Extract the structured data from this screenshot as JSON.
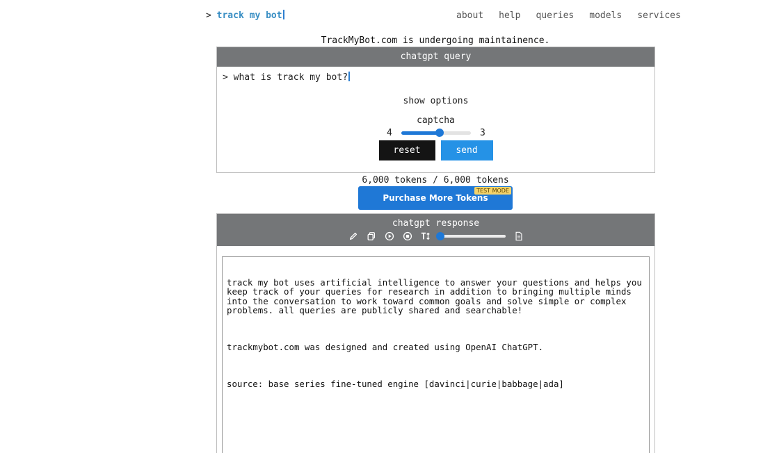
{
  "header": {
    "prompt_symbol": ">",
    "brand": "track my bot",
    "nav": [
      "about",
      "help",
      "queries",
      "models",
      "services"
    ]
  },
  "notice": "TrackMyBot.com is undergoing maintainence.",
  "query_panel": {
    "title": "chatgpt query",
    "prompt_symbol": ">",
    "input_value": "what is track my bot?",
    "show_options": "show options",
    "captcha": {
      "label": "captcha",
      "left_number": "4",
      "right_number": "3",
      "slider_fraction": 0.55
    },
    "reset_label": "reset",
    "send_label": "send"
  },
  "tokens": "6,000 tokens / 6,000 tokens",
  "purchase": {
    "label": "Purchase More Tokens",
    "badge": "TEST MODE"
  },
  "response_panel": {
    "title": "chatgpt response",
    "toolbar_icons": [
      "pen-icon",
      "copy-icon",
      "play-icon",
      "stop-icon",
      "text-size-icon",
      "document-icon"
    ],
    "text_size_fraction": 0.0,
    "paragraphs": [
      "track my bot uses artificial intelligence to answer your questions and helps you keep track of your queries for research in addition to bringing multiple minds into the conversation to work toward common goals and solve simple or complex problems. all queries are publicly shared and searchable!",
      "trackmybot.com was designed and created using OpenAI ChatGPT.",
      "source: base series fine-tuned engine [davinci|curie|babbage|ada]"
    ]
  },
  "colors": {
    "brand": "#3a8fc4",
    "panel_header": "#747678",
    "accent": "#1e78d7",
    "send": "#2592e6",
    "reset": "#141414",
    "badge": "#f5d36a"
  }
}
